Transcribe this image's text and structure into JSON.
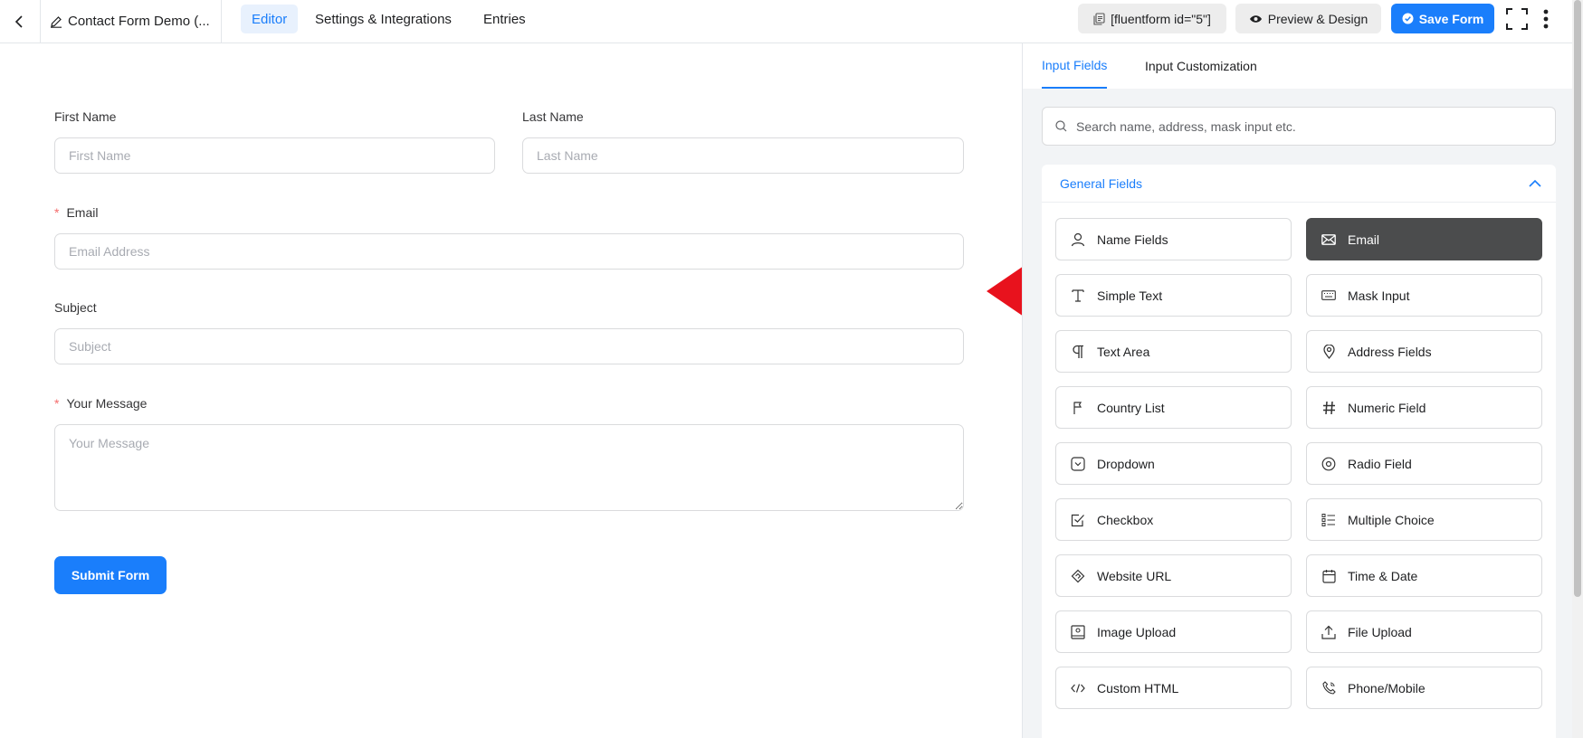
{
  "topbar": {
    "form_title": "Contact Form Demo (...",
    "tabs": [
      {
        "label": "Editor",
        "active": true
      },
      {
        "label": "Settings & Integrations",
        "active": false
      },
      {
        "label": "Entries",
        "active": false
      }
    ],
    "shortcode_label": "[fluentform id=\"5\"]",
    "preview_label": "Preview & Design",
    "save_label": "Save Form"
  },
  "form": {
    "first_name": {
      "label": "First Name",
      "placeholder": "First Name"
    },
    "last_name": {
      "label": "Last Name",
      "placeholder": "Last Name"
    },
    "email": {
      "label": "Email",
      "placeholder": "Email Address",
      "required_mark": "*"
    },
    "subject": {
      "label": "Subject",
      "placeholder": "Subject"
    },
    "message": {
      "label": "Your Message",
      "placeholder": "Your Message",
      "required_mark": "*"
    },
    "submit_label": "Submit Form"
  },
  "sidebar": {
    "tabs": [
      {
        "label": "Input Fields",
        "active": true
      },
      {
        "label": "Input Customization",
        "active": false
      }
    ],
    "search_placeholder": "Search name, address, mask input etc.",
    "section_title": "General Fields",
    "fields": [
      {
        "label": "Name Fields",
        "icon": "user-icon"
      },
      {
        "label": "Email",
        "icon": "envelope-icon",
        "highlighted": true
      },
      {
        "label": "Simple Text",
        "icon": "text-cursor-icon"
      },
      {
        "label": "Mask Input",
        "icon": "keyboard-icon"
      },
      {
        "label": "Text Area",
        "icon": "paragraph-icon"
      },
      {
        "label": "Address Fields",
        "icon": "map-pin-icon"
      },
      {
        "label": "Country List",
        "icon": "flag-icon"
      },
      {
        "label": "Numeric Field",
        "icon": "hash-icon"
      },
      {
        "label": "Dropdown",
        "icon": "dropdown-icon"
      },
      {
        "label": "Radio Field",
        "icon": "radio-icon"
      },
      {
        "label": "Checkbox",
        "icon": "checkbox-icon"
      },
      {
        "label": "Multiple Choice",
        "icon": "list-icon"
      },
      {
        "label": "Website URL",
        "icon": "link-icon"
      },
      {
        "label": "Time & Date",
        "icon": "calendar-icon"
      },
      {
        "label": "Image Upload",
        "icon": "image-icon"
      },
      {
        "label": "File Upload",
        "icon": "upload-icon"
      },
      {
        "label": "Custom HTML",
        "icon": "code-icon"
      },
      {
        "label": "Phone/Mobile",
        "icon": "phone-icon"
      }
    ]
  },
  "colors": {
    "accent": "#1a7efb",
    "highlight_button": "#4b4c4d",
    "required": "#f56c6c",
    "annotation_arrow": "#e8121d"
  }
}
